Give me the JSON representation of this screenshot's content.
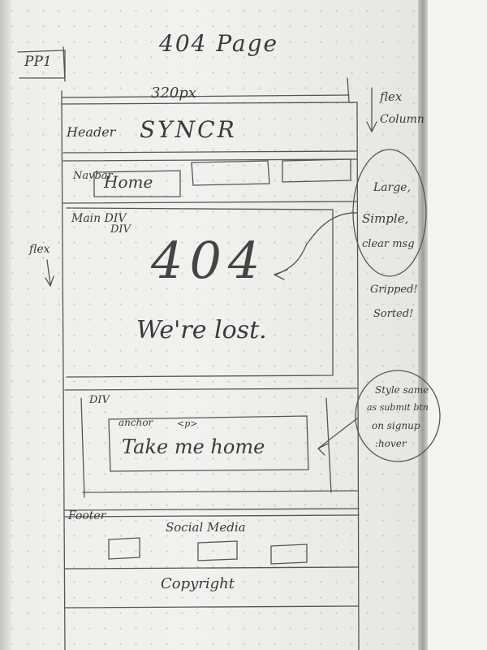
{
  "sheet": {
    "page_tag": "PP1",
    "title": "404 Page",
    "width_label": "320px",
    "flex_note_line1": "flex",
    "flex_note_line2": "Column"
  },
  "header": {
    "label": "Header",
    "brand": "SYNCR"
  },
  "nav": {
    "label": "Navbar",
    "home": "Home"
  },
  "main": {
    "label": "Main DIV",
    "inner_label": "DIV",
    "flex_tag": "flex",
    "code": "404",
    "message": "We're lost."
  },
  "notes": {
    "bubble1": [
      "Large,",
      "Simple,",
      "clear msg"
    ],
    "gripped": "Gripped!",
    "sorted": "Sorted!",
    "bubble2": [
      "Style same",
      "as submit btn",
      "on signup",
      ":hover"
    ]
  },
  "cta": {
    "div_label": "DIV",
    "anchor_label": "anchor",
    "p_label": "<p>",
    "text": "Take me home"
  },
  "footer": {
    "label": "Footer",
    "social": "Social Media",
    "copyright": "Copyright"
  }
}
